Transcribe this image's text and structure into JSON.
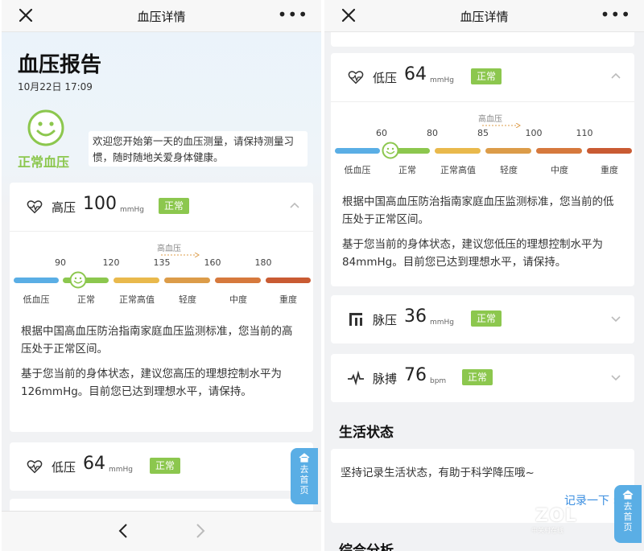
{
  "colors": {
    "accent_green": "#8cc74e",
    "segment_low": "#5aaee5",
    "segment_normal": "#8cc74e",
    "segment_normal_high": "#e9b94c",
    "segment_mild": "#dc9c49",
    "segment_moderate": "#d6793d",
    "segment_severe": "#c95b33",
    "side_tab": "#5aaee5",
    "link": "#3a8ee0"
  },
  "icons": {
    "close": "close-icon",
    "more": "more-icon",
    "smiley": "smiley-icon",
    "heart": "heart-icon",
    "pulse_pressure": "pulse-pressure-icon",
    "heartbeat": "heartbeat-icon",
    "home": "home-icon",
    "chevron_up": "chevron-up-icon",
    "chevron_down": "chevron-down-icon",
    "back": "back-arrow-icon",
    "forward": "forward-arrow-icon"
  },
  "left": {
    "topbar": {
      "title": "血压详情",
      "more": "•••"
    },
    "report": {
      "title": "血压报告",
      "datetime": "10月22日 17:09",
      "status_label": "正常血压",
      "welcome": "欢迎您开始第一天的血压测量，请保持测量习惯，随时随地关爱身体健康。"
    },
    "systolic": {
      "name": "高压",
      "value": "100",
      "unit": "mmHg",
      "badge": "正常",
      "hypertension_label": "高血压",
      "ticks": [
        "90",
        "120",
        "135",
        "160",
        "180"
      ],
      "levels": [
        "低血压",
        "正常",
        "正常高值",
        "轻度",
        "中度",
        "重度"
      ],
      "current_level_index": 1,
      "para1": "根据中国高血压防治指南家庭血压监测标准，您当前的高压处于正常区间。",
      "para2": "基于您当前的身体状态，建议您高压的理想控制水平为126mmHg。目前您已达到理想水平，请保持。"
    },
    "diastolic_preview": {
      "name": "低压",
      "value": "64",
      "unit": "mmHg",
      "badge": "正常"
    },
    "side_tab": "去首页"
  },
  "right": {
    "topbar": {
      "title": "血压详情",
      "more": "•••"
    },
    "diastolic": {
      "name": "低压",
      "value": "64",
      "unit": "mmHg",
      "badge": "正常",
      "hypertension_label": "高血压",
      "ticks": [
        "60",
        "80",
        "85",
        "100",
        "110"
      ],
      "levels": [
        "低血压",
        "正常",
        "正常高值",
        "轻度",
        "中度",
        "重度"
      ],
      "current_level_index": 1,
      "para1": "根据中国高血压防治指南家庭血压监测标准，您当前的低压处于正常区间。",
      "para2": "基于您当前的身体状态，建议您低压的理想控制水平为84mmHg。目前您已达到理想水平，请保持。"
    },
    "pulse_pressure": {
      "name": "脉压",
      "value": "36",
      "unit": "mmHg",
      "badge": "正常"
    },
    "heart_rate": {
      "name": "脉搏",
      "value": "76",
      "unit": "bpm",
      "badge": "正常"
    },
    "life": {
      "heading": "生活状态",
      "text": "坚持记录生活状态，有助于科学降压哦~",
      "link": "记录一下"
    },
    "next_heading": "综合分析",
    "side_tab": "去首页",
    "watermark": "ZOL",
    "watermark_sub": "中关村在线"
  }
}
